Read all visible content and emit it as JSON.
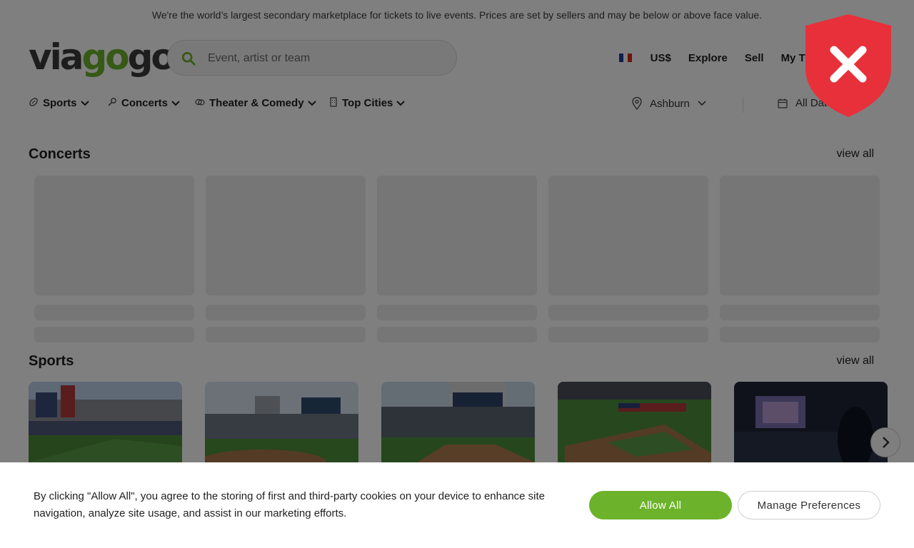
{
  "banner": {
    "text": "We're the world’s largest secondary marketplace for tickets to live events. Prices are set by sellers and may be below or above face value."
  },
  "logo": {
    "part1": "via",
    "part2": "go",
    "part3": "go"
  },
  "search": {
    "placeholder": "Event, artist or team"
  },
  "topnav": {
    "currency": "US$",
    "explore": "Explore",
    "sell": "Sell",
    "my_tickets": "My Tickets"
  },
  "categories": [
    {
      "label": "Sports",
      "icon": "football-icon"
    },
    {
      "label": "Concerts",
      "icon": "microphone-icon"
    },
    {
      "label": "Theater & Comedy",
      "icon": "theater-masks-icon"
    },
    {
      "label": "Top Cities",
      "icon": "building-icon"
    }
  ],
  "location": {
    "label": "Ashburn"
  },
  "dates": {
    "label": "All Dates"
  },
  "sections": {
    "concerts": {
      "title": "Concerts",
      "view_all": "view all"
    },
    "sports": {
      "title": "Sports",
      "view_all": "view all"
    }
  },
  "cookie": {
    "text": "By clicking \"Allow All\", you agree to the storing of first and third-party cookies on your device to enhance site navigation, analyze site usage, and assist in our marketing efforts.",
    "allow_all": "Allow All",
    "manage": "Manage Preferences"
  },
  "colors": {
    "brand_green": "#6cb32b",
    "shield_red": "#e8303a",
    "text": "#1f1f1f"
  }
}
